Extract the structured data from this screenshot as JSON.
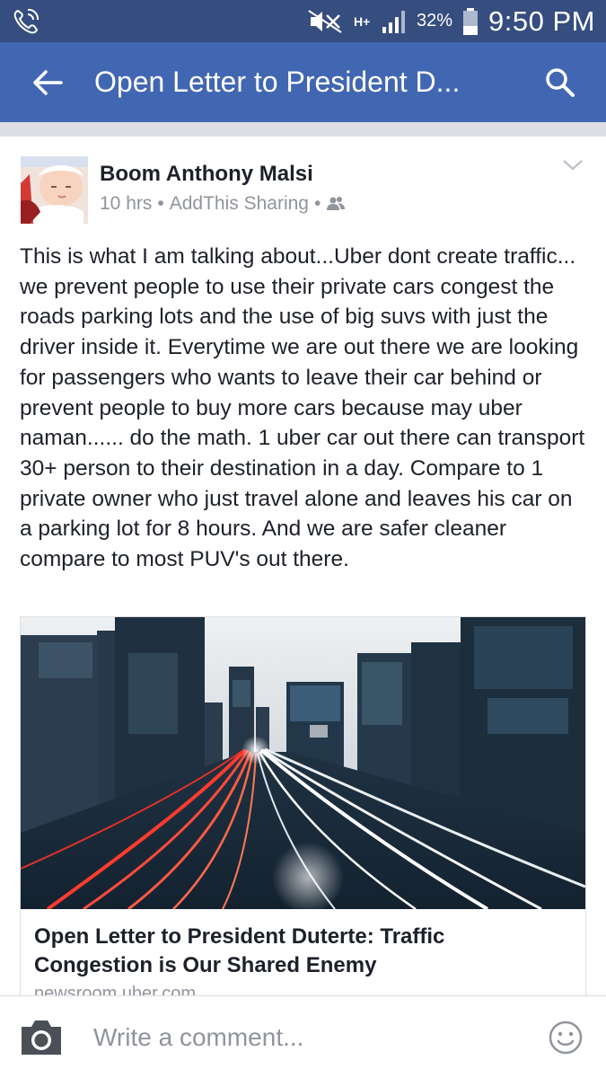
{
  "status_bar": {
    "battery": "32%",
    "time": "9:50 PM",
    "network": "H+",
    "icons": [
      "call-icon",
      "mute-icon",
      "signal-icon",
      "battery-icon"
    ]
  },
  "app_bar": {
    "title": "Open Letter to President D...",
    "icons": [
      "back-arrow-icon",
      "search-icon"
    ],
    "color": "#4267b2"
  },
  "post": {
    "author": "Boom Anthony Malsi",
    "time": "10 hrs",
    "separator": "•",
    "via": "AddThis Sharing",
    "audience_icon": "friends-icon",
    "body": "This is what I am talking about...Uber dont create traffic... we prevent people to use their private cars congest the roads parking lots and the use of big suvs with just the driver inside it. Everytime we are out there we are looking for passengers who wants to leave their car behind or prevent people to buy more cars because may uber naman...... do the math. 1 uber car out there can transport  30+ person to their destination in a day. Compare to 1 private owner who just travel alone and leaves his car on a parking lot for 8 hours. And we are safer cleaner compare to most PUV's out there.",
    "link": {
      "title": "Open Letter to President Duterte: Traffic Congestion is Our Shared Enemy",
      "domain": "newsroom.uber.com"
    }
  },
  "comment_bar": {
    "placeholder": "Write a comment...",
    "icons": [
      "camera-icon",
      "emoji-icon"
    ]
  }
}
